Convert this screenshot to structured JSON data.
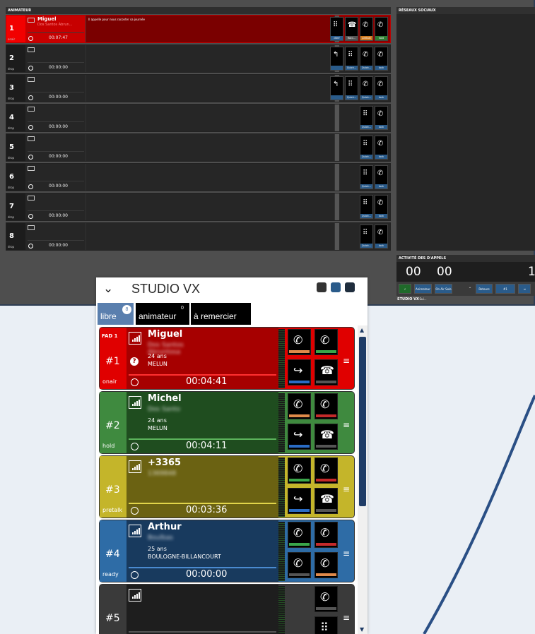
{
  "studio": {
    "animateur_header": "ANIMATEUR",
    "reseaux_header": "RÉSEAUX SOCIAUX",
    "activite_header": "ACTIVITÉ DES D'APPELS",
    "activite_values": [
      "00",
      "00",
      "1"
    ],
    "footer_label": "STUDIO VX",
    "bottom_buttons": [
      "Animateur Sui...",
      "On Air Solo",
      "Retours",
      "#1"
    ],
    "lines": [
      {
        "num": "1",
        "status": "onair",
        "name": "Miguel",
        "subname": "Dos Santos Abrun...",
        "time": "00:07:47",
        "note": "Il appelle pour nous raconter sa journée",
        "buttons": [
          {
            "glyph": "⠿",
            "label": "dtmf"
          },
          {
            "glyph": "☎",
            "label": "Racc..."
          },
          {
            "glyph": "✆",
            "label": "pretalk"
          },
          {
            "glyph": "✆",
            "label": "hold"
          }
        ]
      },
      {
        "num": "2",
        "status": "drop",
        "name": "",
        "subname": "",
        "time": "00:00:00",
        "note": "",
        "buttons": [
          {
            "glyph": "↰",
            "label": ""
          },
          {
            "glyph": "⠿",
            "label": "Quick..."
          },
          {
            "glyph": "✆",
            "label": "Quick..."
          },
          {
            "glyph": "✆",
            "label": "lock"
          }
        ]
      },
      {
        "num": "3",
        "status": "drop",
        "name": "",
        "subname": "",
        "time": "00:00:00",
        "note": "",
        "buttons": [
          {
            "glyph": "↰",
            "label": ""
          },
          {
            "glyph": "⠿",
            "label": "Quick..."
          },
          {
            "glyph": "✆",
            "label": "Quick..."
          },
          {
            "glyph": "✆",
            "label": "lock"
          }
        ]
      },
      {
        "num": "4",
        "status": "drop",
        "name": "",
        "subname": "",
        "time": "00:00:00",
        "note": "",
        "buttons": [
          {
            "glyph": "⠿",
            "label": "Quick..."
          },
          {
            "glyph": "✆",
            "label": "lock"
          }
        ]
      },
      {
        "num": "5",
        "status": "drop",
        "name": "",
        "subname": "",
        "time": "00:00:00",
        "note": "",
        "buttons": [
          {
            "glyph": "⠿",
            "label": "Quick..."
          },
          {
            "glyph": "✆",
            "label": "lock"
          }
        ]
      },
      {
        "num": "6",
        "status": "drop",
        "name": "",
        "subname": "",
        "time": "00:00:00",
        "note": "",
        "buttons": [
          {
            "glyph": "⠿",
            "label": "Quick..."
          },
          {
            "glyph": "✆",
            "label": "lock"
          }
        ]
      },
      {
        "num": "7",
        "status": "drop",
        "name": "",
        "subname": "",
        "time": "00:00:00",
        "note": "",
        "buttons": [
          {
            "glyph": "⠿",
            "label": "Quick..."
          },
          {
            "glyph": "✆",
            "label": "lock"
          }
        ]
      },
      {
        "num": "8",
        "status": "drop",
        "name": "",
        "subname": "",
        "time": "00:00:00",
        "note": "",
        "buttons": [
          {
            "glyph": "⠿",
            "label": "Quick..."
          },
          {
            "glyph": "✆",
            "label": "lock"
          }
        ]
      }
    ]
  },
  "widget": {
    "title": "STUDIO VX",
    "tabs": [
      {
        "label": "libre",
        "count": "8"
      },
      {
        "label": "animateur",
        "count": "0"
      },
      {
        "label": "à remercier",
        "count": ""
      }
    ],
    "cards": [
      {
        "tag": "FAD 1",
        "hash": "#1",
        "status": "onair",
        "name": "Miguel",
        "blurred": "Dos Santos Abruntosa",
        "age": "24 ans",
        "city": "MELUN",
        "time": "00:04:41",
        "question": "?",
        "bg": "#a60000",
        "side": "#e00000",
        "accent": "#ff3030"
      },
      {
        "tag": "",
        "hash": "#2",
        "status": "hold",
        "name": "Michel",
        "blurred": "Dos Santo",
        "age": "24 ans",
        "city": "MELUN",
        "time": "00:04:11",
        "question": "",
        "bg": "#1f4d1f",
        "side": "#3f8a3f",
        "accent": "#5bb35b"
      },
      {
        "tag": "",
        "hash": "#3",
        "status": "pretalk",
        "name": "+3365",
        "blurred": "1369848",
        "age": "",
        "city": "",
        "time": "00:03:36",
        "question": "",
        "bg": "#6b6212",
        "side": "#c4b52a",
        "accent": "#e2d54a"
      },
      {
        "tag": "",
        "hash": "#4",
        "status": "ready",
        "name": "Arthur",
        "blurred": "Boulbas",
        "age": "25 ans",
        "city": "BOULOGNE-BILLANCOURT",
        "time": "00:00:00",
        "question": "",
        "bg": "#183a5e",
        "side": "#2e6ca6",
        "accent": "#4a8ad0"
      },
      {
        "tag": "",
        "hash": "#5",
        "status": "",
        "name": "",
        "blurred": "",
        "age": "",
        "city": "",
        "time": "",
        "question": "",
        "bg": "#1e1e1e",
        "side": "#3a3a3a",
        "accent": "#555555"
      }
    ]
  }
}
